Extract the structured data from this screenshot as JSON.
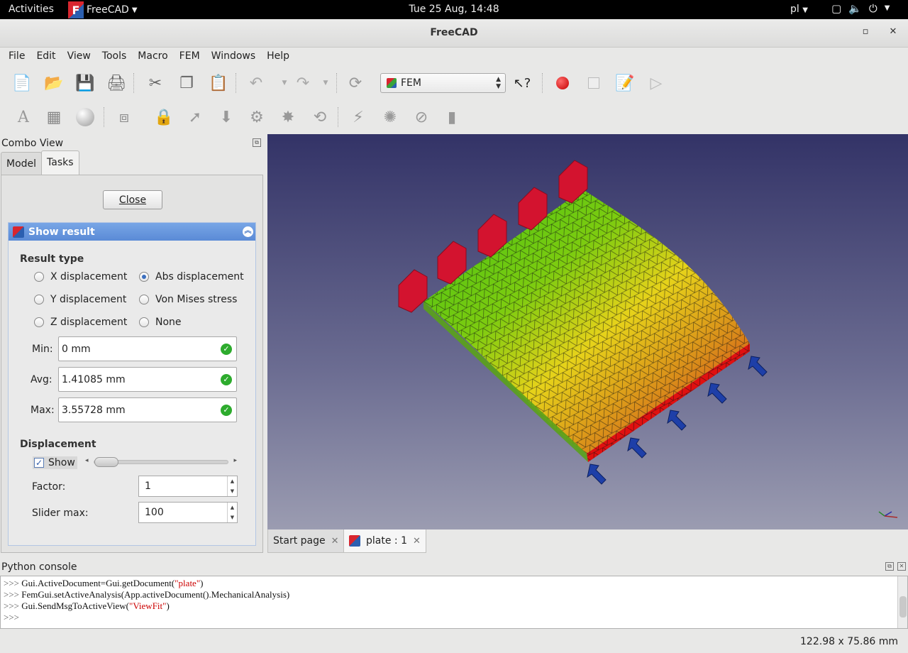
{
  "topbar": {
    "activities": "Activities",
    "app_name": "FreeCAD",
    "clock": "Tue 25 Aug, 14:48",
    "language": "pl"
  },
  "window": {
    "title": "FreeCAD"
  },
  "menu": [
    "File",
    "Edit",
    "View",
    "Tools",
    "Macro",
    "FEM",
    "Windows",
    "Help"
  ],
  "toolbar": {
    "workbench": "FEM"
  },
  "combo": {
    "title": "Combo View",
    "tabs": [
      "Model",
      "Tasks"
    ],
    "active_tab": "Tasks",
    "close_label": "Close",
    "panel_title": "Show result",
    "result_type_label": "Result type",
    "result_types": [
      "X displacement",
      "Abs displacement",
      "Y displacement",
      "Von Mises stress",
      "Z displacement",
      "None"
    ],
    "selected_result": "Abs displacement",
    "min_label": "Min:",
    "min_value": "0 mm",
    "avg_label": "Avg:",
    "avg_value": "1.41085 mm",
    "max_label": "Max:",
    "max_value": "3.55728 mm",
    "displacement_label": "Displacement",
    "show_label": "Show",
    "show_checked": true,
    "slider_value": 1,
    "slider_max": 100,
    "factor_label": "Factor:",
    "factor_value": "1",
    "slider_max_label": "Slider max:",
    "slider_max_value": "100"
  },
  "doc_tabs": [
    "Start page",
    "plate : 1"
  ],
  "active_doc_tab": "plate : 1",
  "console": {
    "title": "Python console",
    "prompt": ">>>",
    "lines": [
      {
        "code": "Gui.ActiveDocument=Gui.getDocument(",
        "str": "\"plate\"",
        "tail": ")"
      },
      {
        "code": "FemGui.setActiveAnalysis(App.activeDocument().MechanicalAnalysis)",
        "str": "",
        "tail": ""
      },
      {
        "code": "Gui.SendMsgToActiveView(",
        "str": "\"ViewFit\"",
        "tail": ")"
      },
      {
        "code": "",
        "str": "",
        "tail": ""
      }
    ]
  },
  "status": {
    "dimensions": "122.98 x 75.86 mm"
  },
  "colors": {
    "fem_high": "#e01010",
    "fem_mid": "#e6d21a",
    "fem_low": "#3cbf14",
    "constraint_fixed": "#d3132f",
    "constraint_force": "#1e3fa8",
    "panel_header": "#5a8ad6"
  }
}
